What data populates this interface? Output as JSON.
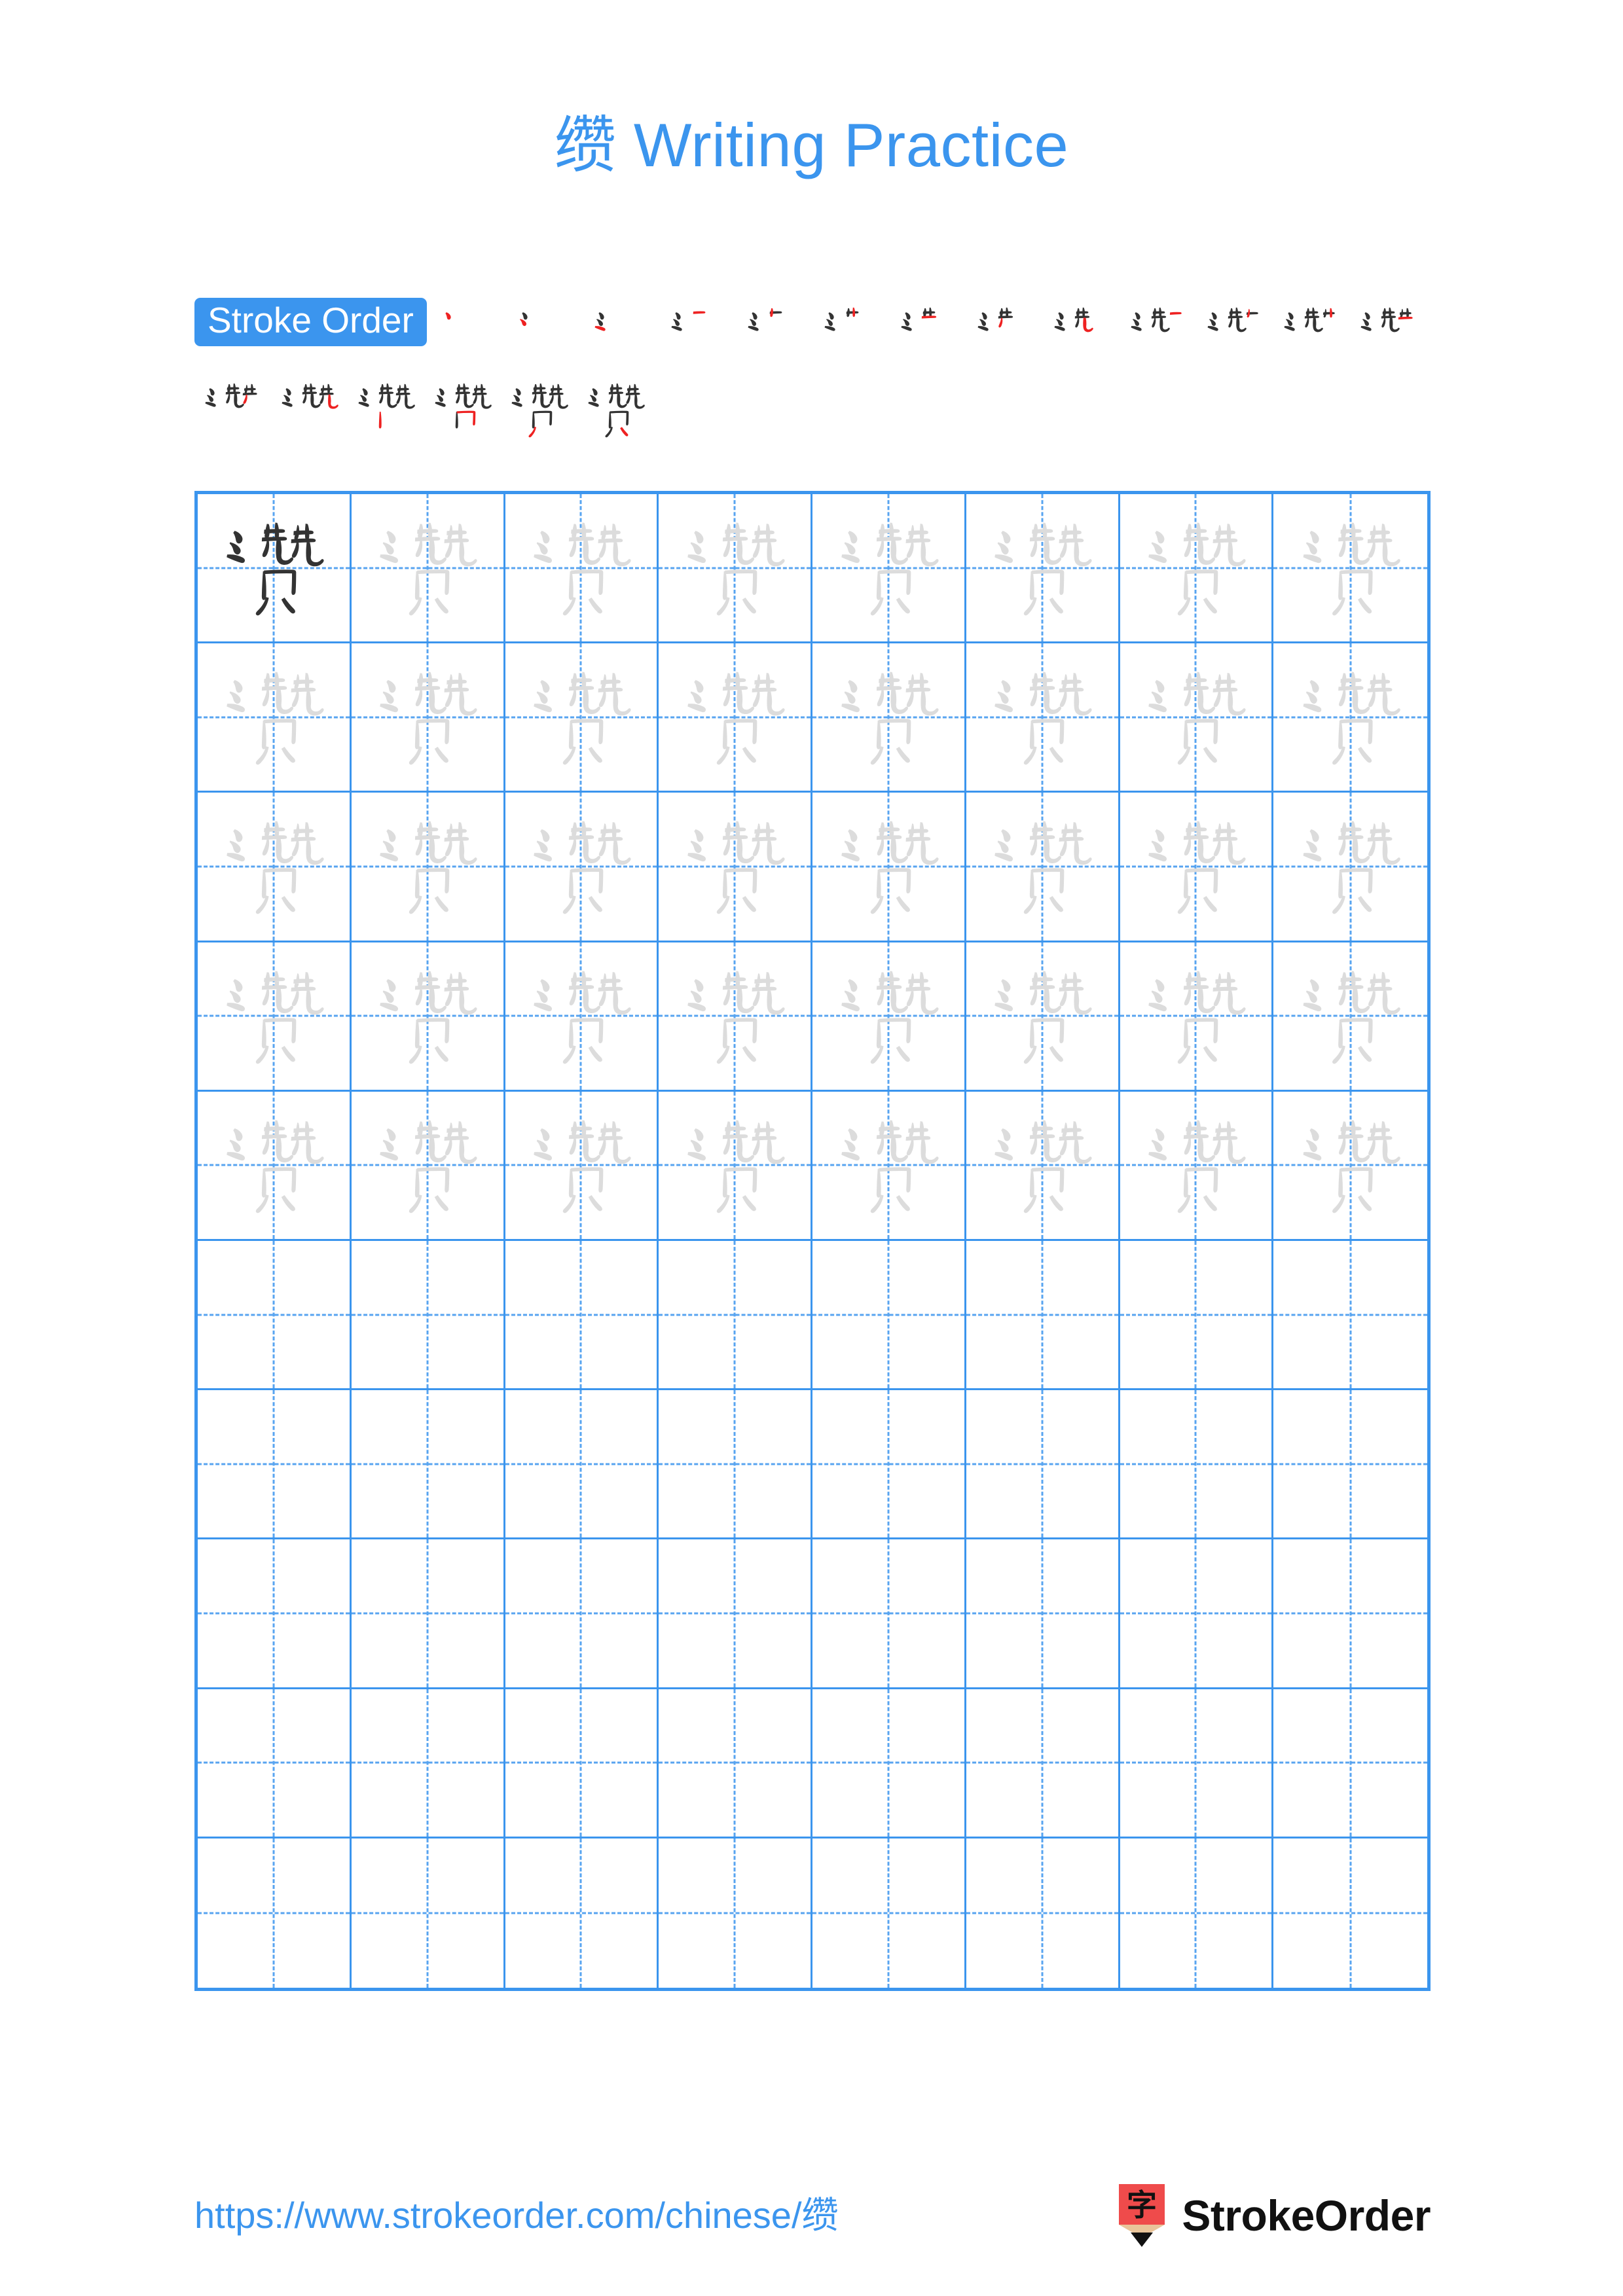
{
  "page": {
    "character": "缵",
    "title": "缵 Writing Practice",
    "background_color": "#ffffff",
    "accent_color": "#3b95ee",
    "stroke_ink_color": "#333333",
    "stroke_highlight_color": "#ee2222",
    "trace_color": "#dcdcdc"
  },
  "stroke_order": {
    "badge_label": "Stroke Order",
    "total_strokes": 19,
    "row1_count": 12,
    "row2_count": 7,
    "steps": [
      1,
      2,
      3,
      4,
      5,
      6,
      7,
      8,
      9,
      10,
      11,
      12,
      13,
      14,
      15,
      16,
      17,
      18,
      19
    ]
  },
  "grid": {
    "columns": 8,
    "rows": 10,
    "filled_rows": 5,
    "empty_rows": 5,
    "example_cell_index": 0,
    "border_color": "#3b95ee",
    "guide_color": "#3b95ee"
  },
  "footer": {
    "url": "https://www.strokeorder.com/chinese/缵",
    "brand_name": "StrokeOrder",
    "brand_mark_character": "字",
    "brand_mark_color": "#ef4b4b"
  }
}
